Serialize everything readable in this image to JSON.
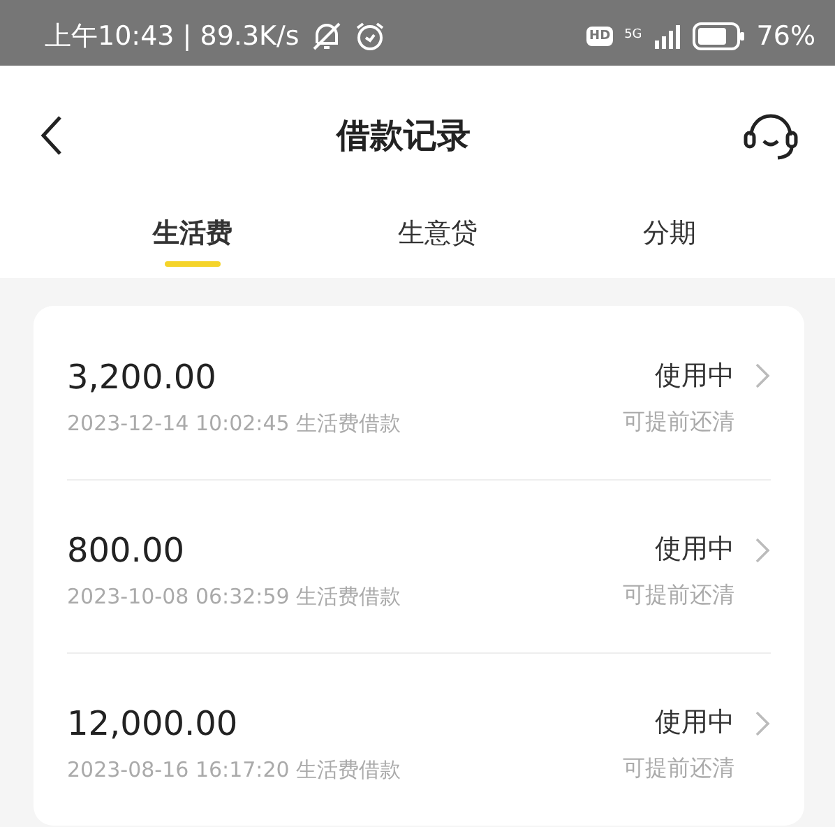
{
  "status_bar": {
    "time": "上午10:43 | 89.3K/s",
    "hd": "HD",
    "network": "5G",
    "battery": "76%"
  },
  "header": {
    "title": "借款记录"
  },
  "tabs": [
    {
      "label": "生活费",
      "selected": true
    },
    {
      "label": "生意贷",
      "selected": false
    },
    {
      "label": "分期",
      "selected": false
    }
  ],
  "records": [
    {
      "amount": "3,200.00",
      "detail": "2023-12-14 10:02:45 生活费借款",
      "status": "使用中",
      "note": "可提前还清"
    },
    {
      "amount": "800.00",
      "detail": "2023-10-08 06:32:59 生活费借款",
      "status": "使用中",
      "note": "可提前还清"
    },
    {
      "amount": "12,000.00",
      "detail": "2023-08-16 16:17:20 生活费借款",
      "status": "使用中",
      "note": "可提前还清"
    }
  ]
}
